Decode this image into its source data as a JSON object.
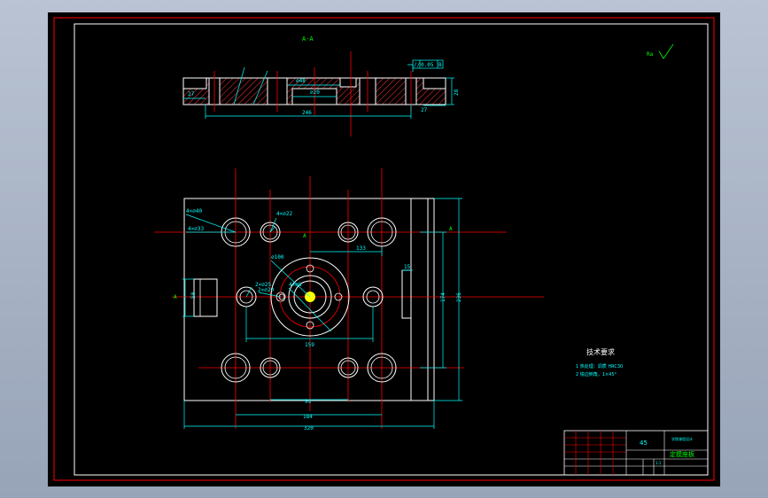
{
  "section_view": {
    "title": "A-A",
    "dims": {
      "d27_left": "27",
      "d48": "⌀48",
      "d20": "⌀20",
      "d246": "246",
      "d27_right": "27",
      "d28": "28"
    },
    "tolerance_frame": {
      "symbol": "//",
      "value": "0.05",
      "datum": "B"
    }
  },
  "roughness_note": "Ra",
  "plan_view": {
    "callouts": {
      "c1": "4×⌀40",
      "c2": "4×⌀22",
      "c3": "4×⌀33",
      "c4": "⌀100",
      "c5": "2×⌀25",
      "c6": "2×⌀20",
      "c7": "4×⌀8",
      "a_mark_left": "A",
      "a_mark_top": "A",
      "a_mark_right": "A"
    },
    "dims": {
      "d133": "133",
      "d15": "15",
      "d50": "50",
      "d174": "174",
      "d236": "236",
      "d159": "159",
      "d99": "99",
      "d184": "184",
      "d320": "320"
    }
  },
  "tech_requirements": {
    "title": "技术要求",
    "items": [
      "1   热处理：调质 HRC30",
      "2   锐边倒角，1×45°"
    ]
  },
  "title_block": {
    "material": "45",
    "part_name": "定模座板",
    "school": "学院课程设计",
    "scale": "1:1"
  },
  "colors": {
    "background": "#000000",
    "border": "#ff0000",
    "outline": "#ffffff",
    "dimension": "#00ffff",
    "centerline": "#ff0000",
    "hatch": "#ff3333",
    "text": "#00ff00",
    "feature": "#ffff00"
  }
}
